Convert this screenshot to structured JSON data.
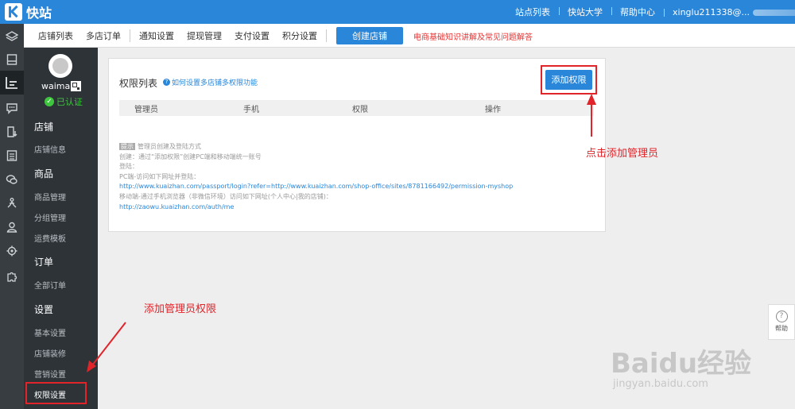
{
  "topbar": {
    "app_name": "快站",
    "nav": [
      "站点列表",
      "快站大学",
      "帮助中心"
    ],
    "user": "xinglu211338@..."
  },
  "subnav": {
    "items": [
      "店铺列表",
      "多店订单",
      "通知设置",
      "提现管理",
      "支付设置",
      "积分设置"
    ],
    "create_button": "创建店铺",
    "promo_link": "电商基础知识讲解及常见问题解答"
  },
  "profile": {
    "name": "waimai",
    "verified": "已认证"
  },
  "sidebar": {
    "sections": [
      {
        "label": "店铺",
        "items": [
          "店铺信息"
        ]
      },
      {
        "label": "商品",
        "items": [
          "商品管理",
          "分组管理",
          "运费模板"
        ]
      },
      {
        "label": "订单",
        "items": [
          "全部订单"
        ]
      },
      {
        "label": "设置",
        "items": [
          "基本设置",
          "店铺装修",
          "营销设置",
          "权限设置"
        ]
      }
    ],
    "active": "权限设置"
  },
  "panel": {
    "title": "权限列表",
    "help_link": "如何设置多店铺多权限功能",
    "add_button": "添加权限",
    "columns": [
      "管理员",
      "手机",
      "权限",
      "操作"
    ],
    "tips": {
      "tag": "提示",
      "heading": "管理员创建及登陆方式",
      "lines": [
        "创建：通过“添加权限”创建PC端和移动端统一账号",
        "登陆：",
        "PC端-访问如下网址并登陆："
      ],
      "pc_url": "http://www.kuaizhan.com/passport/login?refer=http://www.kuaizhan.com/shop-office/sites/8781166492/permission-myshop",
      "mobile_line": "移动端-通过手机浏览器（非微信环境）访问如下网址(个人中心|我的店铺)：",
      "mobile_url": "http://zaowu.kuaizhan.com/auth/me"
    }
  },
  "annotations": {
    "click_add_admin": "点击添加管理员",
    "add_admin_permission": "添加管理员权限",
    "color": "#e0242a"
  },
  "help_widget": {
    "label": "帮助"
  },
  "watermark": {
    "brand": "Baidu经验",
    "domain": "jingyan.baidu.com"
  },
  "colors": {
    "brand_blue": "#2a86d9",
    "sidebar_dark": "#2e3338",
    "rail_dark": "#373d41",
    "highlight_red": "#e0242a"
  }
}
